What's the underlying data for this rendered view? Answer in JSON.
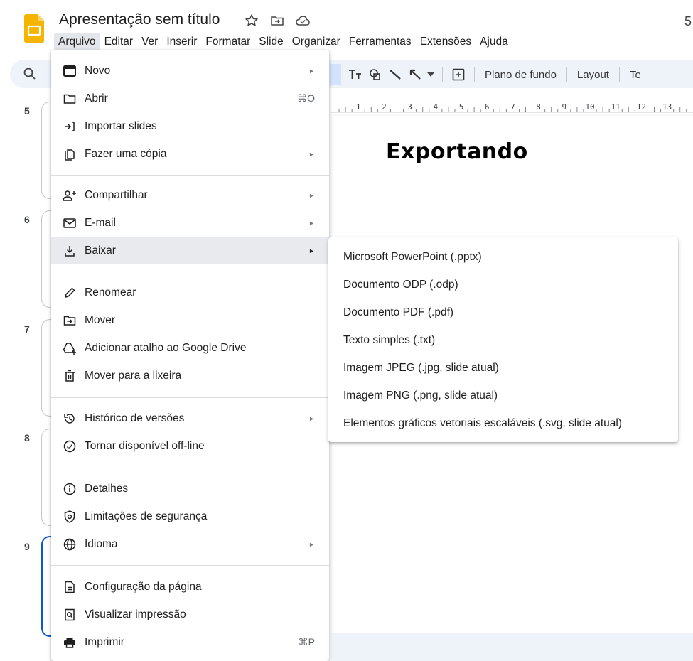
{
  "app": {
    "title": "Apresentação sem título",
    "corner_text": "5",
    "brand_color": "#f4b400",
    "title_icons": [
      "star-icon",
      "move-to-folder-icon",
      "cloud-status-icon"
    ]
  },
  "menubar": [
    {
      "label": "Arquivo",
      "active": true
    },
    {
      "label": "Editar"
    },
    {
      "label": "Ver"
    },
    {
      "label": "Inserir"
    },
    {
      "label": "Formatar"
    },
    {
      "label": "Slide"
    },
    {
      "label": "Organizar"
    },
    {
      "label": "Ferramentas"
    },
    {
      "label": "Extensões"
    },
    {
      "label": "Ajuda"
    }
  ],
  "toolbar": {
    "background": "Plano de fundo",
    "layout": "Layout",
    "truncated": "Te",
    "icons": [
      "text-box-icon",
      "shapes-icon",
      "line-icon",
      "arrow-icon",
      "dropdown-icon",
      "new-comment-icon"
    ]
  },
  "ruler": {
    "numbers": [
      "1",
      "2",
      "3",
      "4",
      "5",
      "6",
      "7",
      "8",
      "9",
      "10",
      "11",
      "12",
      "13"
    ]
  },
  "slides_panel": {
    "numbers": [
      "5",
      "6",
      "7",
      "8",
      "9"
    ],
    "selected": "9"
  },
  "slide": {
    "heading": "Exportando"
  },
  "file_menu": {
    "items": [
      {
        "label": "Novo",
        "icon": "new-slides-icon",
        "submenu": true
      },
      {
        "label": "Abrir",
        "icon": "folder-open-icon",
        "shortcut": "⌘O"
      },
      {
        "label": "Importar slides",
        "icon": "import-icon"
      },
      {
        "label": "Fazer uma cópia",
        "icon": "copy-icon",
        "submenu": true
      },
      {
        "label": "Compartilhar",
        "icon": "share-person-icon",
        "submenu": true
      },
      {
        "label": "E-mail",
        "icon": "email-icon",
        "submenu": true
      },
      {
        "label": "Baixar",
        "icon": "download-icon",
        "submenu": true,
        "highlighted": true
      },
      {
        "label": "Renomear",
        "icon": "pencil-icon"
      },
      {
        "label": "Mover",
        "icon": "move-folder-icon"
      },
      {
        "label": "Adicionar atalho ao Google Drive",
        "icon": "drive-shortcut-icon"
      },
      {
        "label": "Mover para a lixeira",
        "icon": "trash-icon"
      },
      {
        "label": "Histórico de versões",
        "icon": "history-icon",
        "submenu": true
      },
      {
        "label": "Tornar disponível off-line",
        "icon": "offline-icon"
      },
      {
        "label": "Detalhes",
        "icon": "info-icon"
      },
      {
        "label": "Limitações de segurança",
        "icon": "security-shield-icon"
      },
      {
        "label": "Idioma",
        "icon": "globe-icon",
        "submenu": true
      },
      {
        "label": "Configuração da página",
        "icon": "page-setup-icon"
      },
      {
        "label": "Visualizar impressão",
        "icon": "print-preview-icon"
      },
      {
        "label": "Imprimir",
        "icon": "printer-icon",
        "shortcut": "⌘P"
      }
    ]
  },
  "download_submenu": {
    "items": [
      "Microsoft PowerPoint (.pptx)",
      "Documento ODP (.odp)",
      "Documento PDF (.pdf)",
      "Texto simples (.txt)",
      "Imagem JPEG (.jpg, slide atual)",
      "Imagem PNG (.png, slide atual)",
      "Elementos gráficos vetoriais escaláveis (.svg, slide atual)"
    ]
  }
}
